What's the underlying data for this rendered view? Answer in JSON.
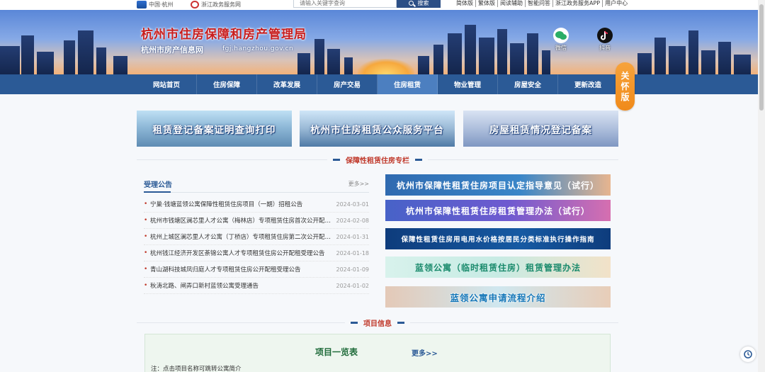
{
  "topbar": {
    "gov_logo_text": "中国·杭州",
    "zj_logo_text": "浙江政务服务网",
    "search_placeholder": "请输入关键字查询",
    "search_button": "搜索",
    "links": [
      "简体版",
      "繁体版",
      "阅读辅助",
      "智能问答",
      "浙江政务服务APP",
      "用户中心"
    ]
  },
  "header": {
    "title": "杭州市住房保障和房产管理局",
    "subtitle": "杭州市房产信息网",
    "url": "fgj.hangzhou.gov.cn",
    "wechat_label": "微信",
    "douyin_label": "抖音"
  },
  "nav": {
    "items": [
      "网站首页",
      "住房保障",
      "改革发展",
      "房产交易",
      "住房租赁",
      "物业管理",
      "房屋安全",
      "更新改造"
    ],
    "active": "住房租赁"
  },
  "care_mode": [
    "关",
    "怀",
    "版"
  ],
  "services": [
    "租赁登记备案证明查询打印",
    "杭州市住房租赁公众服务平台",
    "房屋租赁情况登记备案"
  ],
  "section1_title": "保障性租赁住房专栏",
  "announcements": {
    "title": "受理公告",
    "more": "更多>>",
    "items": [
      {
        "text": "宁巢·钱塘蓝领公寓保障性租赁住房项目（一期）招租公告",
        "date": "2024-03-01"
      },
      {
        "text": "杭州市钱塘区澜芯里人才公寓（梅林店）专项租赁住房首次公开配租...",
        "date": "2024-02-08"
      },
      {
        "text": "杭州上城区澜芯里人才公寓（丁桥店）专项租赁住房第二次公开配租...",
        "date": "2024-01-31"
      },
      {
        "text": "杭州钱江经济开发区荼锦公寓人才专项租赁住房公开配租受理公告",
        "date": "2024-01-18"
      },
      {
        "text": "青山湖科技城凤归庭人才专项租赁住房公开配租受理公告",
        "date": "2024-01-09"
      },
      {
        "text": "秋涛北路、闸弄口新村蓝领公寓受理通告",
        "date": "2024-01-02"
      }
    ]
  },
  "policy_banners": [
    "杭州市保障性租赁住房项目认定指导意见（试行）",
    "杭州市保障性租赁住房租赁管理办法（试行）",
    "保障性租赁住房用电用水价格按居民分类标准执行操作指南",
    "蓝领公寓（临时租赁住房）租赁管理办法",
    "蓝领公寓申请流程介绍"
  ],
  "section2_title": "项目信息",
  "project": {
    "title": "项目一览表",
    "more": "更多>>",
    "note": "注：点击项目名称可跳转公寓简介"
  }
}
